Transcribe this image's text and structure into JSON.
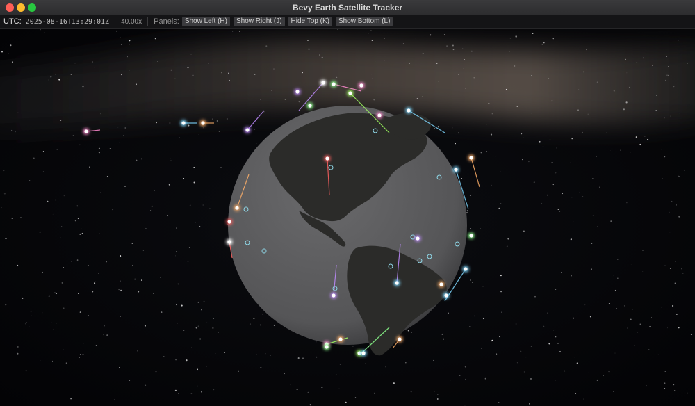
{
  "window": {
    "title": "Bevy Earth Satellite Tracker"
  },
  "topbar": {
    "utc_label": "UTC:",
    "utc_value": "2025-08-16T13:29:01Z",
    "speed": "40.00x",
    "panels_label": "Panels:",
    "buttons": [
      "Show Left (H)",
      "Show Right (J)",
      "Hide Top (K)",
      "Show Bottom (L)"
    ]
  },
  "colors": {
    "earth_ocean": "#5e5e60",
    "earth_land": "#2a2a28",
    "satellite_palette": [
      "#ff8ad0",
      "#c08cff",
      "#8cff8c",
      "#ffb06a",
      "#7fd8ff",
      "#ffffff",
      "#a0ff60",
      "#ff6060"
    ]
  },
  "icons": [
    "ground-station-icon",
    "satellite-marker-icon"
  ]
}
